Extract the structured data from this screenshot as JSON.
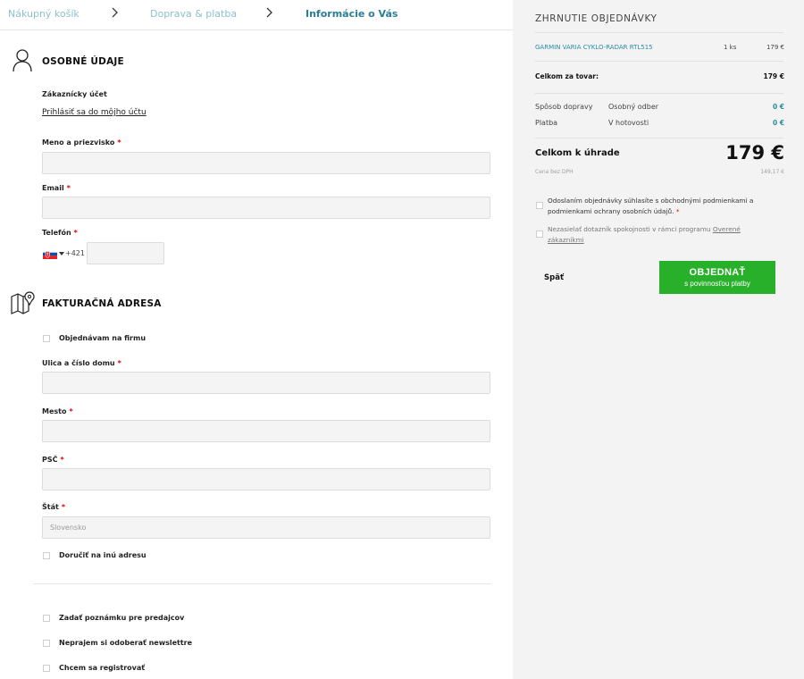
{
  "steps": [
    {
      "label": "Nákupný košík"
    },
    {
      "label": "Doprava & platba"
    },
    {
      "label": "Informácie o Vás"
    }
  ],
  "personal": {
    "title": "OSOBNÉ ÚDAJE",
    "account_label": "Zákaznícky účet",
    "login_link": "Prihlásiť sa do môjho účtu",
    "name_label": "Meno a priezvisko",
    "email_label": "Email",
    "phone_label": "Telefón",
    "phone_code": "+421",
    "required_mark": "*"
  },
  "billing": {
    "title": "FAKTURAČNÁ ADRESA",
    "company_checkbox": "Objednávam na firmu",
    "street_label": "Ulica a číslo domu",
    "city_label": "Mesto",
    "zip_label": "PSČ",
    "country_label": "Štát",
    "country_value": "Slovensko",
    "other_address_checkbox": "Doručiť na inú adresu"
  },
  "extras": {
    "note_checkbox": "Zadať poznámku pre predajcov",
    "newsletter_checkbox": "Neprajem si odoberať newslettre",
    "register_checkbox": "Chcem sa registrovať"
  },
  "summary": {
    "title": "ZHRNUTIE OBJEDNÁVKY",
    "product_name": "GARMIN VARIA CYKLO-RADAR RTL515",
    "product_qty": "1 ks",
    "product_price": "179 €",
    "goods_total_label": "Celkom za tovar:",
    "goods_total_value": "179 €",
    "shipping_label": "Spôsob dopravy",
    "shipping_value": "Osobný odber",
    "shipping_price": "0 €",
    "payment_label": "Platba",
    "payment_value": "V hotovosti",
    "payment_price": "0 €",
    "grand_total_label": "Celkom k úhrade",
    "grand_total_value": "179 €",
    "vat_label": "Cena bez DPH",
    "vat_value": "149,17 €",
    "terms_text": "Odoslaním objednávky súhlasíte s obchodnými podmienkami a podmienkami ochrany osobních údajů.",
    "required_mark": "*",
    "survey_text": "Nezasielať dotazník spokojnosti v rámci programu",
    "survey_link": "Overené zákazníkmi",
    "back_label": "Späť",
    "order_button_line1": "OBJEDNAŤ",
    "order_button_line2": "s povinnosťou platby"
  },
  "colors": {
    "accent": "#2a8ca5",
    "button_green": "#29b02b",
    "required_red": "#dd0000"
  }
}
